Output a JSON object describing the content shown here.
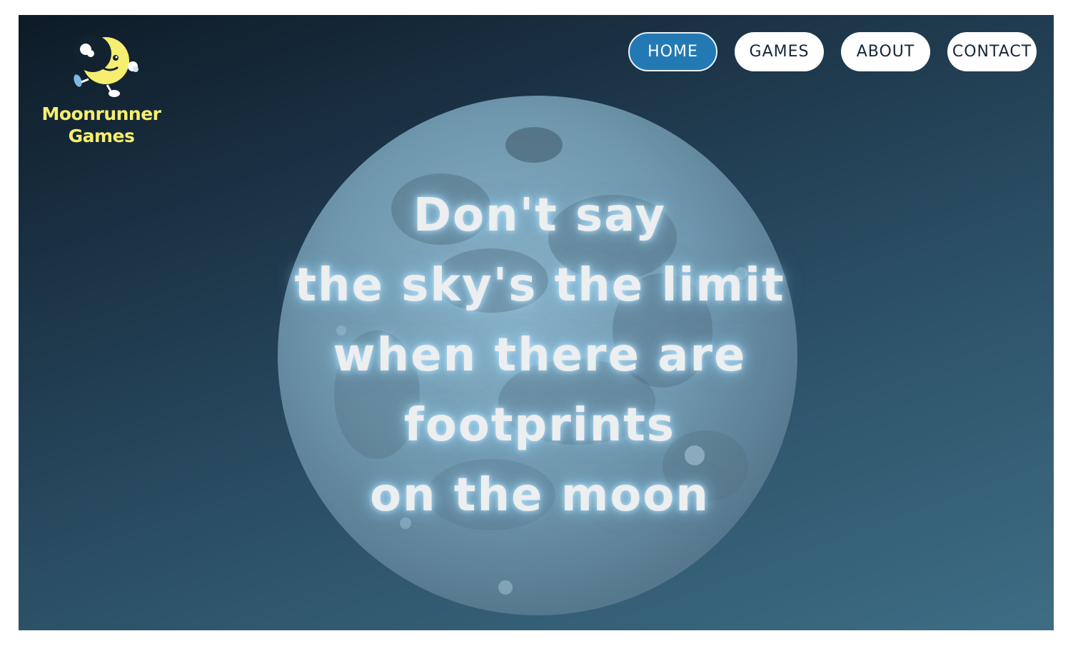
{
  "brand": {
    "name_line1": "Moonrunner",
    "name_line2": "Games",
    "logo_icon": "moon-runner-mascot-icon",
    "color": "#f6ee70"
  },
  "nav": {
    "items": [
      {
        "label": "HOME",
        "active": true
      },
      {
        "label": "GAMES",
        "active": false
      },
      {
        "label": "ABOUT",
        "active": false
      },
      {
        "label": "CONTACT",
        "active": false
      }
    ],
    "active_color": "#2379b3"
  },
  "hero": {
    "lines": [
      "Don't say",
      "the sky's the limit",
      "when there are",
      "footprints",
      "on the moon"
    ],
    "image": "full-moon-image"
  }
}
